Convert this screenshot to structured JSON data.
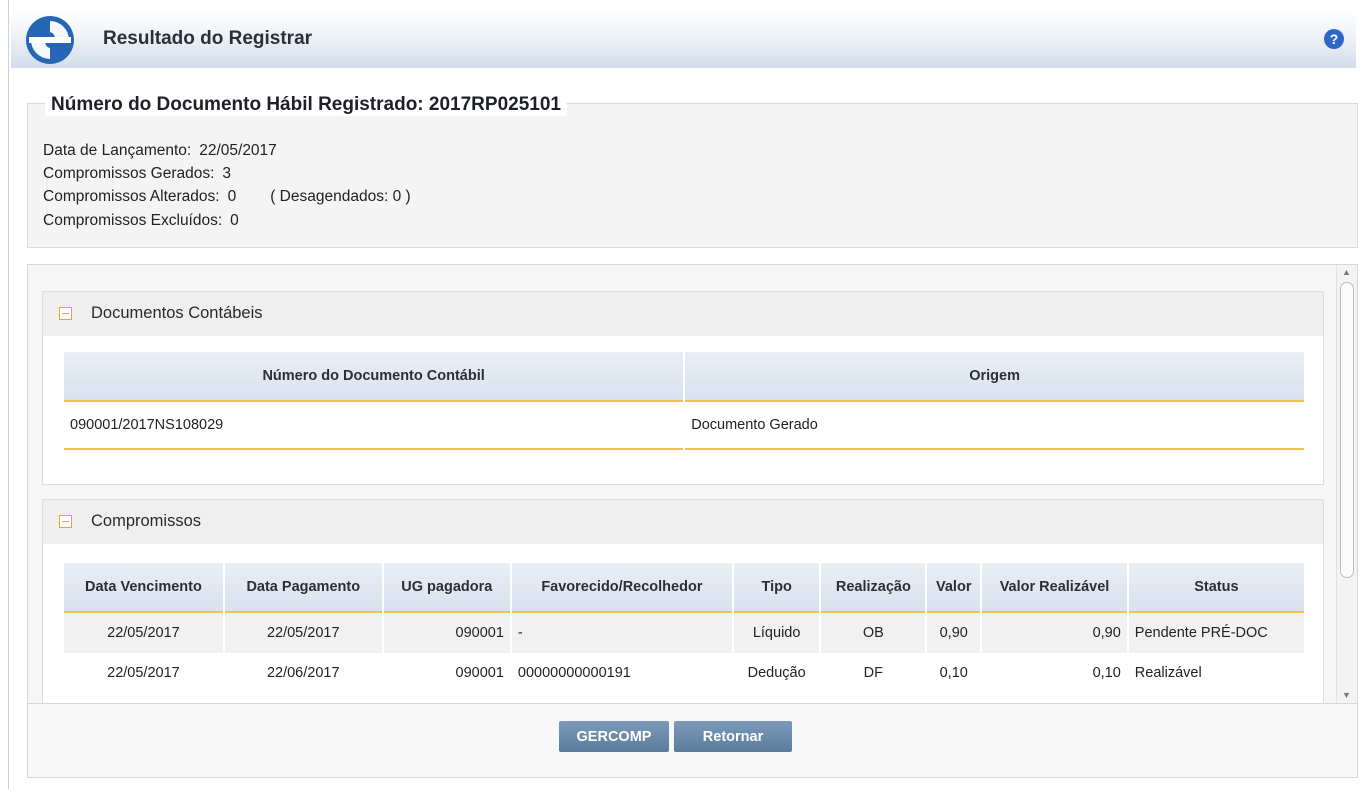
{
  "header": {
    "title": "Resultado do Registrar",
    "help_icon": "help-icon",
    "help_glyph": "?"
  },
  "summary": {
    "legend": "Número do Documento Hábil Registrado: 2017RP025101",
    "data_lancamento_label": "Data de Lançamento:",
    "data_lancamento_value": "22/05/2017",
    "gerados_label": "Compromissos Gerados:",
    "gerados_value": "3",
    "alterados_label": "Compromissos Alterados:",
    "alterados_value": "0",
    "desagendados": "( Desagendados: 0 )",
    "excluidos_label": "Compromissos Excluídos:",
    "excluidos_value": "0"
  },
  "documentos": {
    "title": "Documentos Contábeis",
    "columns": [
      "Número do Documento Contábil",
      "Origem"
    ],
    "rows": [
      [
        "090001/2017NS108029",
        "Documento Gerado"
      ]
    ]
  },
  "compromissos": {
    "title": "Compromissos",
    "columns": [
      "Data Vencimento",
      "Data Pagamento",
      "UG pagadora",
      "Favorecido/Recolhedor",
      "Tipo",
      "Realização",
      "Valor",
      "Valor Realizável",
      "Status"
    ],
    "rows": [
      [
        "22/05/2017",
        "22/05/2017",
        "090001",
        "-",
        "Líquido",
        "OB",
        "0,90",
        "0,90",
        "Pendente PRÉ-DOC"
      ],
      [
        "22/05/2017",
        "22/06/2017",
        "090001",
        "00000000000191",
        "Dedução",
        "DF",
        "0,10",
        "0,10",
        "Realizável"
      ]
    ]
  },
  "footer": {
    "gercomp_label": "GERCOMP",
    "retornar_label": "Retornar"
  },
  "colors": {
    "accent_yellow": "#f0c14b",
    "button": "#6a89a9",
    "help": "#2f67c8"
  }
}
